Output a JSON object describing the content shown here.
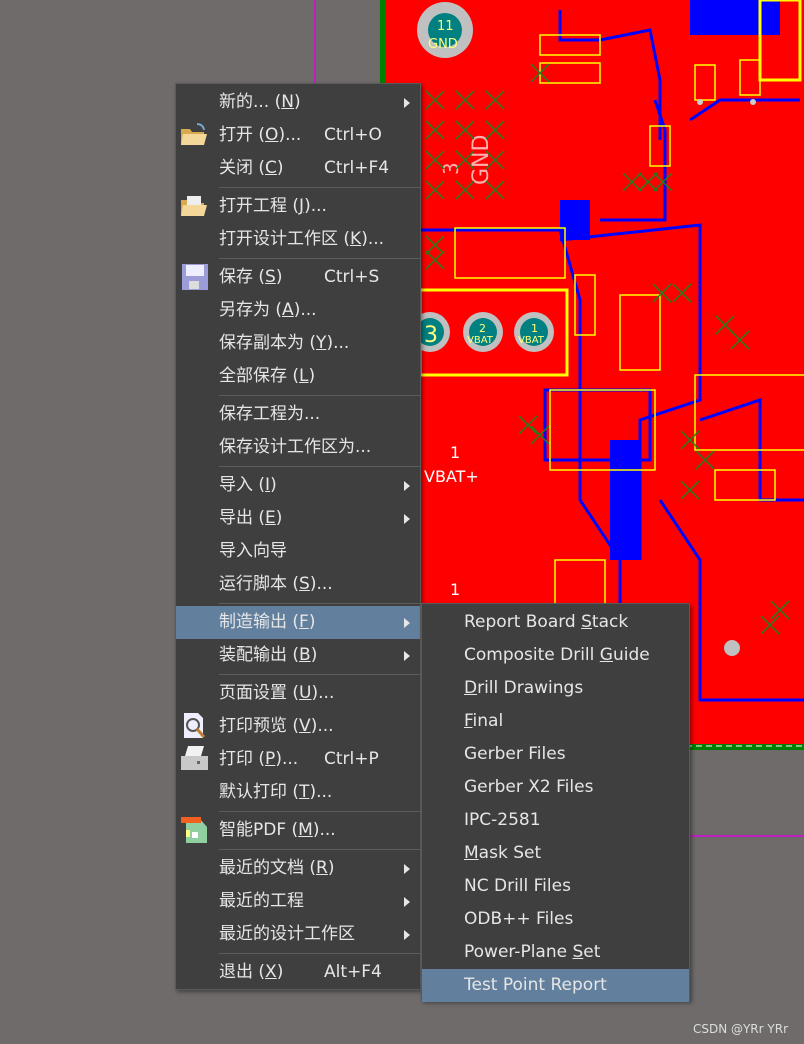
{
  "main_menu": {
    "groups": [
      [
        {
          "pre": "新的... (",
          "key": "N",
          "post": ")",
          "submenu": true
        },
        {
          "pre": "打开 (",
          "key": "O",
          "post": ")...",
          "shortcut": "Ctrl+O",
          "icon": "open-folder-icon"
        },
        {
          "pre": "关闭 (",
          "key": "C",
          "post": ")",
          "shortcut": "Ctrl+F4"
        }
      ],
      [
        {
          "pre": "打开工程 (",
          "key": "J",
          "post": ")...",
          "icon": "open-project-icon"
        },
        {
          "pre": "打开设计工作区 (",
          "key": "K",
          "post": ")..."
        }
      ],
      [
        {
          "pre": "保存 (",
          "key": "S",
          "post": ")",
          "shortcut": "Ctrl+S",
          "icon": "save-disk-icon"
        },
        {
          "pre": "另存为 (",
          "key": "A",
          "post": ")..."
        },
        {
          "pre": "保存副本为 (",
          "key": "Y",
          "post": ")..."
        },
        {
          "pre": "全部保存 (",
          "key": "L",
          "post": ")"
        }
      ],
      [
        {
          "pre": "保存工程为...",
          "key": "",
          "post": ""
        },
        {
          "pre": "保存设计工作区为...",
          "key": "",
          "post": ""
        }
      ],
      [
        {
          "pre": "导入 (",
          "key": "I",
          "post": ")",
          "submenu": true
        },
        {
          "pre": "导出 (",
          "key": "E",
          "post": ")",
          "submenu": true
        },
        {
          "pre": "导入向导",
          "key": "",
          "post": ""
        },
        {
          "pre": "运行脚本 (",
          "key": "S",
          "post": ")..."
        }
      ],
      [
        {
          "pre": "制造输出 (",
          "key": "F",
          "post": ")",
          "submenu": true,
          "highlighted": true
        },
        {
          "pre": "装配输出 (",
          "key": "B",
          "post": ")",
          "submenu": true
        }
      ],
      [
        {
          "pre": "页面设置 (",
          "key": "U",
          "post": ")..."
        },
        {
          "pre": "打印预览 (",
          "key": "V",
          "post": ")...",
          "icon": "print-preview-icon"
        },
        {
          "pre": "打印 (",
          "key": "P",
          "post": ")...",
          "shortcut": "Ctrl+P",
          "icon": "printer-icon"
        },
        {
          "pre": "默认打印 (",
          "key": "T",
          "post": ")..."
        }
      ],
      [
        {
          "pre": "智能PDF (",
          "key": "M",
          "post": ")...",
          "icon": "smart-pdf-icon"
        }
      ],
      [
        {
          "pre": "最近的文档 (",
          "key": "R",
          "post": ")",
          "submenu": true
        },
        {
          "pre": "最近的工程",
          "key": "",
          "post": "",
          "submenu": true
        },
        {
          "pre": "最近的设计工作区",
          "key": "",
          "post": "",
          "submenu": true
        }
      ],
      [
        {
          "pre": "退出 (",
          "key": "X",
          "post": ")",
          "shortcut": "Alt+F4"
        }
      ]
    ]
  },
  "sub_menu": {
    "items": [
      {
        "pre": "Report Board ",
        "key": "S",
        "post": "tack"
      },
      {
        "pre": "Composite Drill ",
        "key": "G",
        "post": "uide"
      },
      {
        "pre": "",
        "key": "D",
        "post": "rill Drawings"
      },
      {
        "pre": "",
        "key": "F",
        "post": "inal"
      },
      {
        "pre": "Gerber Files",
        "key": "",
        "post": ""
      },
      {
        "pre": "Gerber X2 Files",
        "key": "",
        "post": ""
      },
      {
        "pre": "IPC-2581",
        "key": "",
        "post": ""
      },
      {
        "pre": "",
        "key": "M",
        "post": "ask Set"
      },
      {
        "pre": "NC Drill Files",
        "key": "",
        "post": ""
      },
      {
        "pre": "ODB++ Files",
        "key": "",
        "post": ""
      },
      {
        "pre": "Power-Plane ",
        "key": "S",
        "post": "et"
      },
      {
        "pre": "Test Point Report",
        "key": "",
        "post": "",
        "highlighted": true
      }
    ]
  },
  "pcb": {
    "labels": {
      "pad11": "11",
      "pad11_net": "GND",
      "u4_pin": "3",
      "u4_net": "GND",
      "pad3": "3",
      "pad2": "2",
      "pad2_net": "VBAT",
      "pad1": "1",
      "pad1_net": "VBAT",
      "vbat_num": "1",
      "vbat_net": "VBAT+",
      "gnd_num": "1"
    }
  },
  "colors": {
    "menu_bg": "#3f3f3f",
    "highlight": "#62809e",
    "copper_top": "#ff0000",
    "copper_bottom": "#0000ff",
    "silkscreen": "#ffff00",
    "background": "#6f6b6b"
  },
  "watermark": "CSDN @YRr YRr"
}
